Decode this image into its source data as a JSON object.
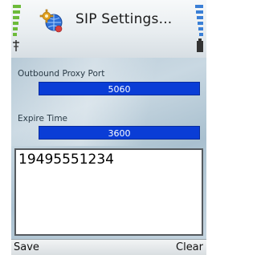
{
  "header": {
    "title": "SIP Settings...",
    "signal_icon": "signal-strength-icon",
    "app_icon": "sip-settings-app-icon",
    "battery_icon": "battery-level-icon"
  },
  "settings": {
    "outbound_proxy_port": {
      "label": "Outbound Proxy Port",
      "value": "5060"
    },
    "expire_time": {
      "label": "Expire Time",
      "value": "3600"
    }
  },
  "editor": {
    "value": "19495551234"
  },
  "softkeys": {
    "left_label": "Save",
    "right_label": "Clear"
  },
  "colors": {
    "field_background": "#0a3dd6",
    "content_background": "#b6c9d6",
    "header_background": "#e8edf0"
  }
}
